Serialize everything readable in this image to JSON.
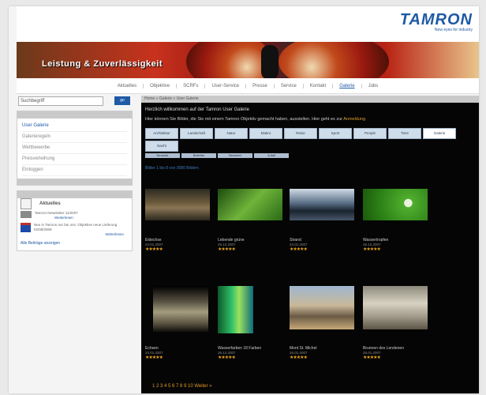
{
  "header": {
    "brand": "TAMRON",
    "tagline": "New eyes for industry"
  },
  "banner": {
    "title": "Leistung & Zuverlässigkeit"
  },
  "nav": {
    "items": [
      "Aktuelles",
      "Objektive",
      "SCRFs",
      "User-Service",
      "Presse",
      "Service",
      "Kontakt",
      "Galerie",
      "Jobs"
    ],
    "active_index": 7
  },
  "search": {
    "value": "Suchbegriff",
    "button": "go"
  },
  "sidebar_menu": {
    "items": [
      "User Galerie",
      "Galerieregeln",
      "Wettbewerbe",
      "Preisverleihung",
      "Einloggen"
    ],
    "active_index": 0
  },
  "news": {
    "title": "Aktuelles",
    "items": [
      {
        "text": "Tamron Newsletter 11/2007",
        "more": "Weiterlesen"
      },
      {
        "text": "Neu in Tamron nur bei uns: Objektive neue Lieferung 02/08/2009",
        "more": "Weiterlesen"
      }
    ],
    "all_link": "Alle Beiträge anzeigen"
  },
  "breadcrumb": "Home » Galerie » User Galerie",
  "welcome": "Herzlich willkommen auf der Tamron User Galerie",
  "intro": {
    "text": "Hier können Sie Bilder, die Sie mit einem Tamron Objektiv gemacht haben, ausstellen. Hier geht es zur",
    "link": "Anmeldung"
  },
  "tabs": [
    "Architektur",
    "Landschaft",
    "Natur",
    "Makro",
    "Reise",
    "Sport",
    "People",
    "Tiere",
    "Galerie",
    "Nacht"
  ],
  "active_tab": 8,
  "subtabs": [
    "Neueste",
    "Beliebte",
    "Bewertet",
    "Zufall"
  ],
  "counter": "Bilder 1 bis 8 von 3080 Bildern",
  "photos": [
    {
      "title": "Eidechse",
      "date": "24.01.2007",
      "stars": "★★★★★"
    },
    {
      "title": "Lebende grüne",
      "date": "26.12.2007",
      "stars": "★★★★★"
    },
    {
      "title": "Strand",
      "date": "24.01.2007",
      "stars": "★★★★★"
    },
    {
      "title": "Wassertropfen",
      "date": "26.12.2007",
      "stars": "★★★★★"
    },
    {
      "title": "Echsen",
      "date": "24.01.2007",
      "stars": "★★★★★"
    },
    {
      "title": "Wasserfarben 18 Farben",
      "date": "26.12.2007",
      "stars": "★★★★★"
    },
    {
      "title": "Mont St. Michel",
      "date": "26.01.2007",
      "stars": "★★★★★"
    },
    {
      "title": "Brunnen des Lendenen",
      "date": "26.01.2007",
      "stars": "★★★★★"
    }
  ],
  "pager": "1 2 3 4 5 6 7 8 9 10 Weiter »",
  "colors": {
    "accent": "#1e5aa6",
    "link_orange": "#e29a2a",
    "main_bg": "#050505"
  }
}
